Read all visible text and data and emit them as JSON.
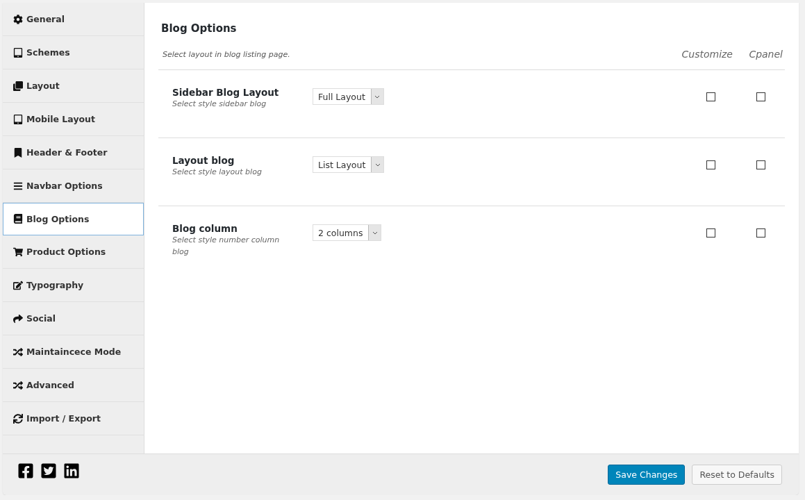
{
  "sidebar": {
    "items": [
      {
        "label": "General",
        "selected": false
      },
      {
        "label": "Schemes",
        "selected": false
      },
      {
        "label": "Layout",
        "selected": false
      },
      {
        "label": "Mobile Layout",
        "selected": false
      },
      {
        "label": "Header & Footer",
        "selected": false
      },
      {
        "label": "Navbar Options",
        "selected": false
      },
      {
        "label": "Blog Options",
        "selected": true
      },
      {
        "label": "Product Options",
        "selected": false
      },
      {
        "label": "Typography",
        "selected": false
      },
      {
        "label": "Social",
        "selected": false
      },
      {
        "label": "Maintaincece Mode",
        "selected": false
      },
      {
        "label": "Advanced",
        "selected": false
      },
      {
        "label": "Import / Export",
        "selected": false
      }
    ]
  },
  "section": {
    "title": "Blog Options",
    "description": "Select layout in blog listing page.",
    "columns": [
      "Customize",
      "Cpanel"
    ]
  },
  "options": [
    {
      "label": "Sidebar Blog Layout",
      "hint": "Select style sidebar blog",
      "value": "Full Layout",
      "customize": false,
      "cpanel": false
    },
    {
      "label": "Layout blog",
      "hint": "Select style layout blog",
      "value": "List Layout",
      "customize": false,
      "cpanel": false
    },
    {
      "label": "Blog column",
      "hint": "Select style number column blog",
      "value": "2 columns",
      "customize": false,
      "cpanel": false
    }
  ],
  "buttons": [
    {
      "label": "Save Changes",
      "kind": "primary"
    },
    {
      "label": "Reset to Defaults",
      "kind": "secondary"
    }
  ]
}
